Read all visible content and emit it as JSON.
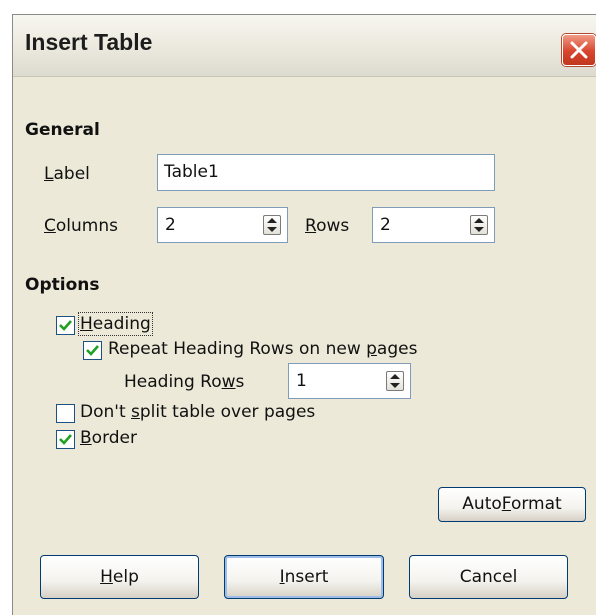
{
  "window": {
    "title": "Insert Table"
  },
  "general": {
    "heading": "General",
    "label_caption": "Label",
    "label_value": "Table1",
    "columns_caption": "Columns",
    "columns_value": "2",
    "rows_caption": "Rows",
    "rows_value": "2"
  },
  "options": {
    "heading": "Options",
    "heading_checkbox": {
      "label": "Heading",
      "checked": true
    },
    "repeat_heading": {
      "label": "Repeat Heading Rows on new pages",
      "checked": true
    },
    "heading_rows_caption": "Heading Rows",
    "heading_rows_value": "1",
    "dont_split": {
      "label": "Don't split table over pages",
      "checked": false
    },
    "border": {
      "label": "Border",
      "checked": true
    }
  },
  "buttons": {
    "autoformat": "AutoFormat",
    "help": "Help",
    "insert": "Insert",
    "cancel": "Cancel"
  },
  "icons": [
    "close-icon",
    "spin-arrows-icon",
    "checkmark-icon"
  ],
  "colors": {
    "dialog_bg": "#ece9d8",
    "close_red": "#d8452d",
    "check_green": "#21a121"
  }
}
